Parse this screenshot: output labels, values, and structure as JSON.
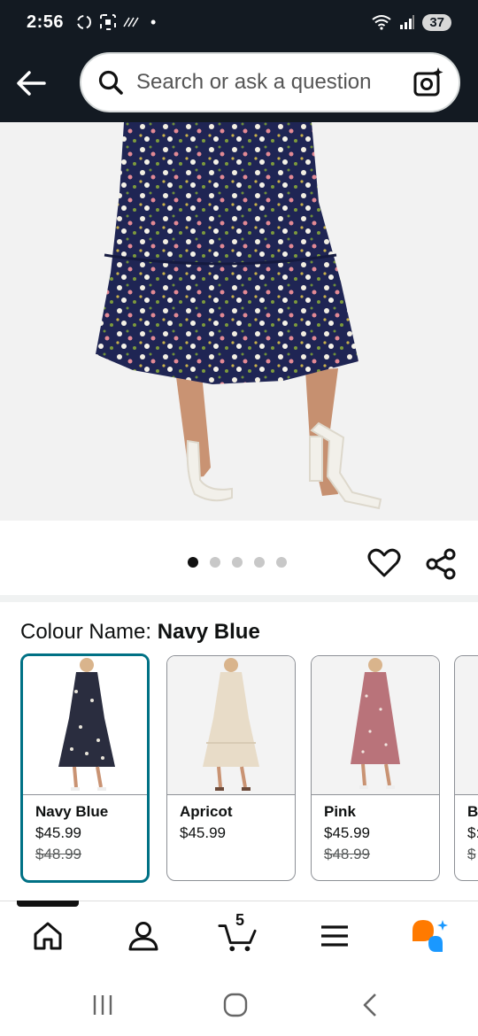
{
  "status_bar": {
    "time": "2:56",
    "battery": "37"
  },
  "search": {
    "placeholder": "Search or ask a question"
  },
  "gallery": {
    "image_count": 5,
    "active_index": 0
  },
  "colour": {
    "label": "Colour Name: ",
    "selected_value": "Navy Blue",
    "swatches": [
      {
        "name": "Navy Blue",
        "price": "$45.99",
        "old_price": "$48.99"
      },
      {
        "name": "Apricot",
        "price": "$45.99",
        "old_price": ""
      },
      {
        "name": "Pink",
        "price": "$45.99",
        "old_price": "$48.99"
      },
      {
        "name": "Bl",
        "price": "$:",
        "old_price": "$"
      }
    ]
  },
  "bottom_nav": {
    "cart_count": "5",
    "items": [
      "home-icon",
      "account-icon",
      "cart-icon",
      "menu-icon",
      "rufus-icon"
    ]
  },
  "colors": {
    "header_bg": "#131a22",
    "selected_border": "#007185"
  }
}
